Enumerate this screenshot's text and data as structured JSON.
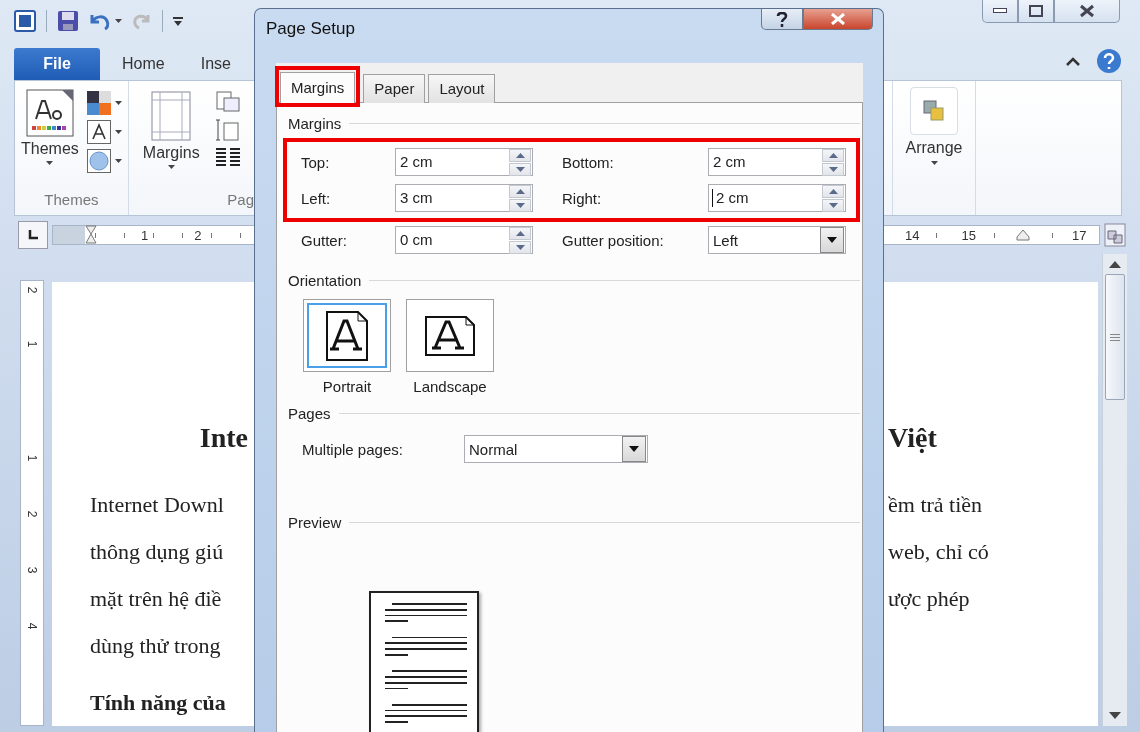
{
  "word": {
    "tabs": [
      {
        "label": "File",
        "kind": "file"
      },
      {
        "label": "Home",
        "kind": "plain"
      },
      {
        "label": "Inse",
        "kind": "plain"
      }
    ],
    "ribbon": {
      "groups": [
        {
          "kind": "themes",
          "button": "Themes",
          "label": "Themes"
        },
        {
          "kind": "page_setup",
          "button": "Margins",
          "label": "Pag"
        }
      ],
      "arrange_button": "Arrange"
    },
    "ruler": {
      "left_numbers": [
        "1",
        "2"
      ],
      "right_numbers": [
        "14",
        "15",
        "17"
      ],
      "vertical_numbers": [
        "2",
        "1",
        "1",
        "2",
        "3",
        "4"
      ]
    },
    "document": {
      "heading_left": "Inte",
      "heading_right": "Việt",
      "lines_left": [
        "Internet Downl",
        "thông dụng giú",
        "mặt trên hệ điề",
        "dùng thử trong"
      ],
      "lines_right": [
        "ềm trả tiền",
        "web, chỉ có",
        "ược phép"
      ],
      "bold_line_left": "Tính năng của"
    }
  },
  "dialog": {
    "title": "Page Setup",
    "tabs": [
      {
        "label": "Margins",
        "selected": true,
        "highlighted": true
      },
      {
        "label": "Paper",
        "selected": false,
        "highlighted": false
      },
      {
        "label": "Layout",
        "selected": false,
        "highlighted": false
      }
    ],
    "margins": {
      "heading": "Margins",
      "highlighted": true,
      "fields": [
        {
          "label": "Top:",
          "value": "2 cm",
          "focused": false
        },
        {
          "label": "Bottom:",
          "value": "2 cm",
          "focused": false
        },
        {
          "label": "Left:",
          "value": "3 cm",
          "focused": false
        },
        {
          "label": "Right:",
          "value": "2 cm",
          "focused": true
        }
      ]
    },
    "gutter": {
      "label": "Gutter:",
      "value": "0 cm"
    },
    "gutter_position": {
      "label": "Gutter position:",
      "value": "Left"
    },
    "orientation": {
      "heading": "Orientation",
      "options": [
        {
          "label": "Portrait",
          "kind": "portrait",
          "selected": true
        },
        {
          "label": "Landscape",
          "kind": "landscape",
          "selected": false
        }
      ]
    },
    "pages": {
      "heading": "Pages",
      "label": "Multiple pages:",
      "value": "Normal"
    },
    "preview": {
      "heading": "Preview"
    }
  }
}
